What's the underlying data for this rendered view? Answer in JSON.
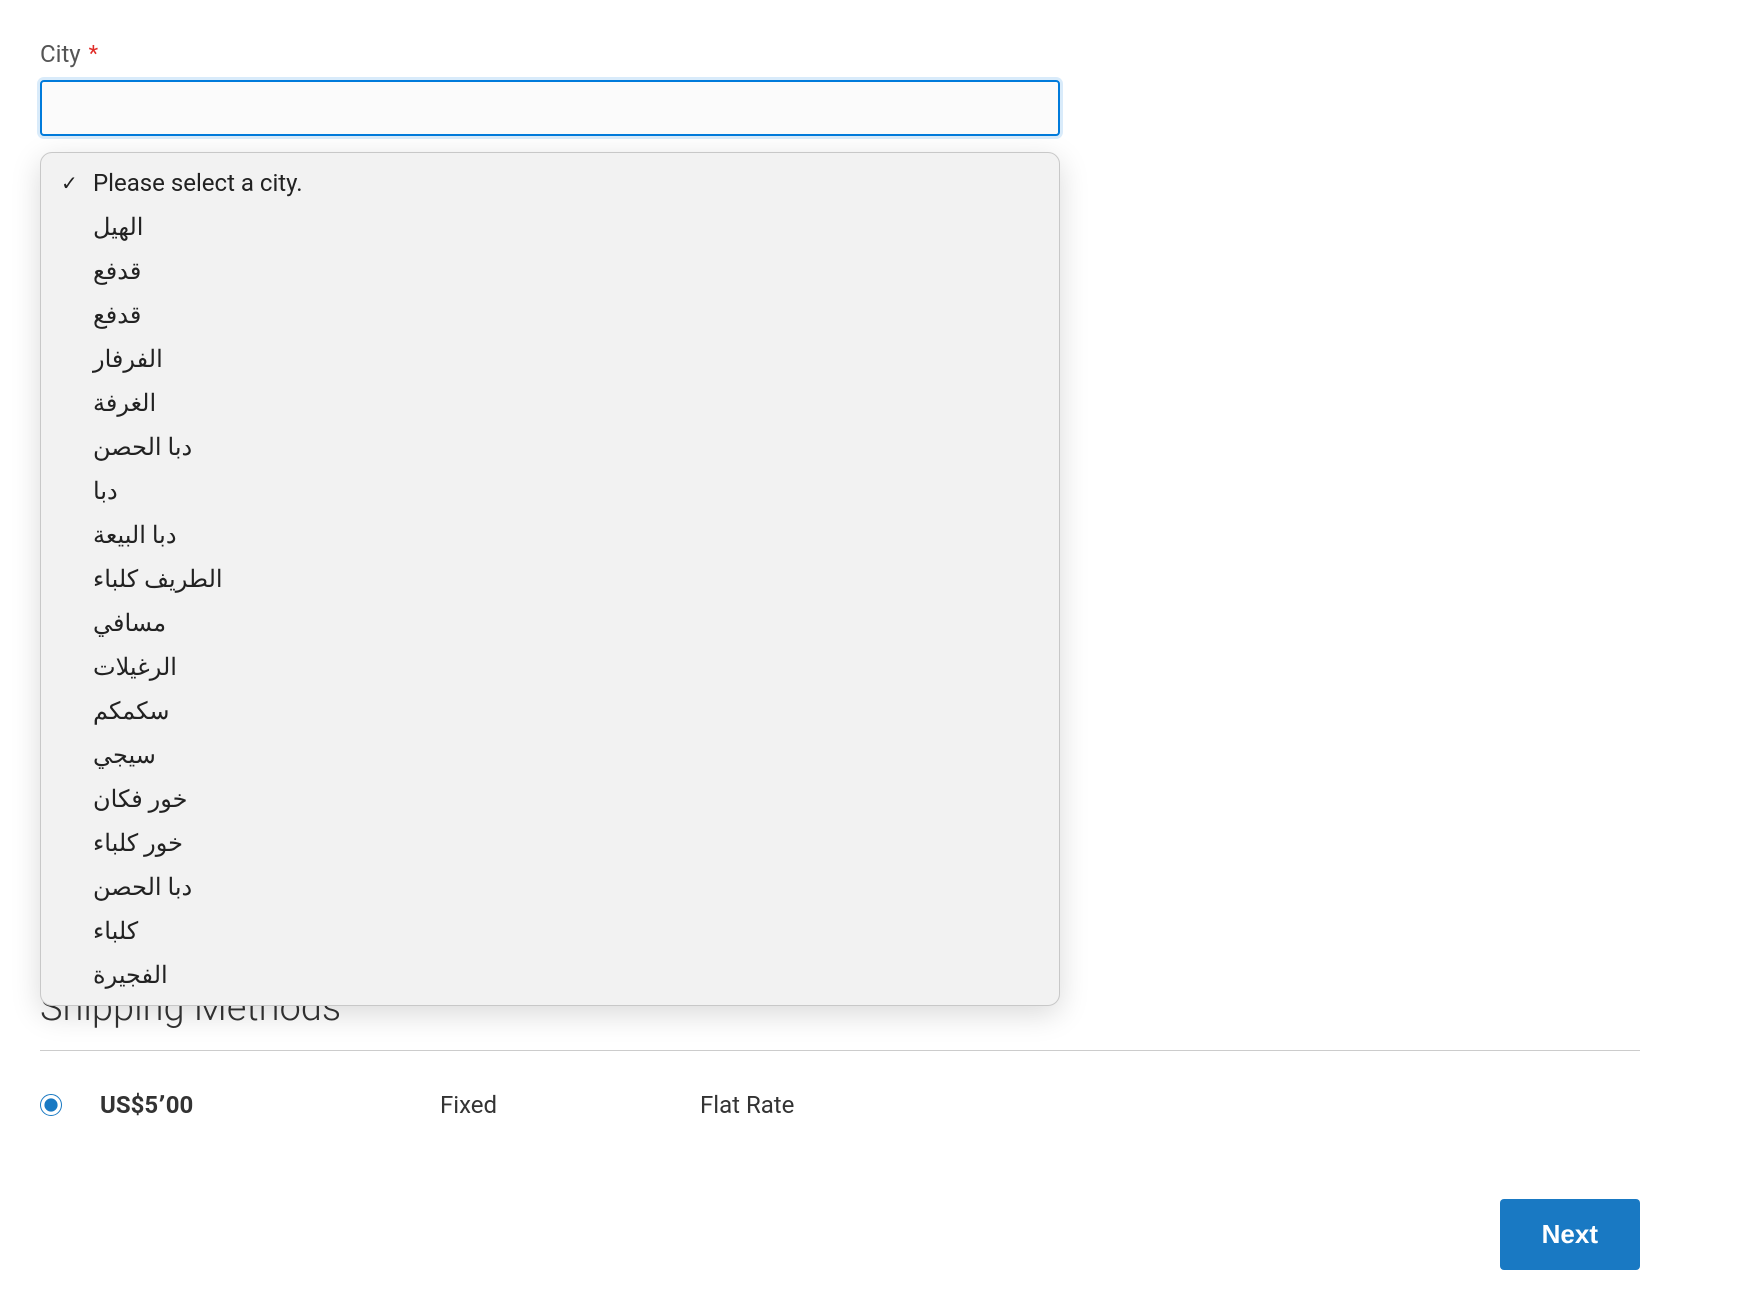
{
  "form": {
    "city": {
      "label": "City",
      "required_mark": "*",
      "placeholder_option": "Please select a city.",
      "options": [
        "الهيل",
        "قدفع",
        "قدفع",
        "الفرفار",
        "الغرفة",
        "دبا الحصن",
        "دبا",
        "دبا البيعة",
        "الطريف كلباء",
        "مسافي",
        "الرغيلات",
        "سكمكم",
        "سيجي",
        "خور فكان",
        "خور كلباء",
        "دبا الحصن",
        "كلباء",
        "الفجيرة"
      ]
    }
  },
  "shipping": {
    "heading": "Shipping Methods",
    "row": {
      "price": "US$5٬00",
      "method": "Fixed",
      "carrier": "Flat Rate"
    }
  },
  "buttons": {
    "next": "Next"
  }
}
